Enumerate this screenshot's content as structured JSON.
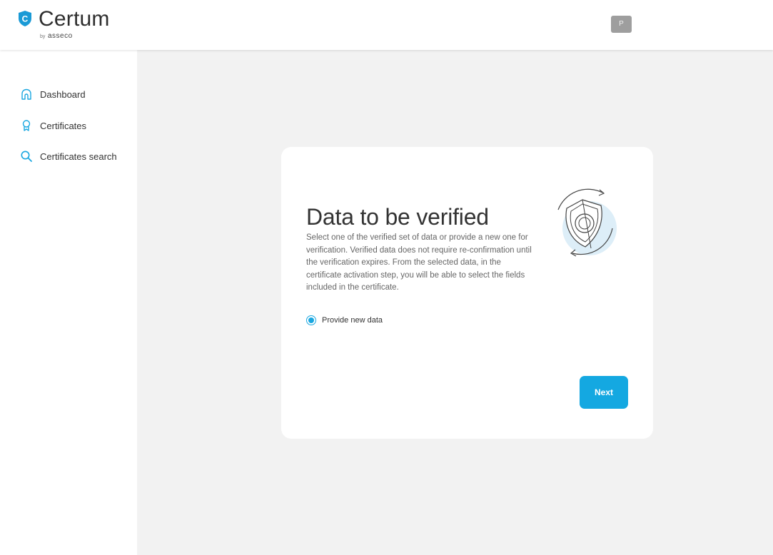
{
  "brand": {
    "name": "Certum",
    "by": "by",
    "parent": "asseco",
    "badge_letter": "C"
  },
  "user": {
    "avatar_initial": "P"
  },
  "sidebar": {
    "items": [
      {
        "label": "Dashboard",
        "icon": "home-icon"
      },
      {
        "label": "Certificates",
        "icon": "award-icon"
      },
      {
        "label": "Certificates search",
        "icon": "search-icon"
      }
    ]
  },
  "card": {
    "title": "Data to be verified",
    "description": "Select one of the verified set of data or provide a new one for verification. Verified data does not require re-confirmation until the verification expires. From the selected data, in the certificate activation step, you will be able to select the fields included in the certificate.",
    "option_label": "Provide new data",
    "option_selected": true,
    "next_label": "Next"
  },
  "colors": {
    "accent": "#14a8e1",
    "badge": "#1a9ad6",
    "background": "#f2f2f2",
    "avatar": "#9e9e9e"
  }
}
